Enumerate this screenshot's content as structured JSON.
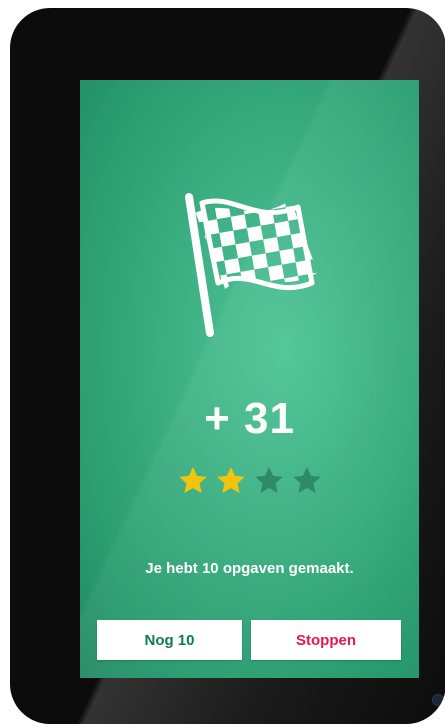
{
  "result": {
    "score": "+ 31",
    "stars_earned": 2,
    "stars_total": 4,
    "message": "Je hebt 10 opgaven gemaakt."
  },
  "buttons": {
    "again_label": "Nog 10",
    "stop_label": "Stoppen"
  },
  "icons": {
    "flag": "checkered-flag-icon",
    "star": "star-icon"
  },
  "colors": {
    "screen_bg": "#3fb285",
    "star_filled": "#f1c40f",
    "star_empty": "#2f8a6a",
    "again_text": "#127a52",
    "stop_text": "#e5194a"
  }
}
